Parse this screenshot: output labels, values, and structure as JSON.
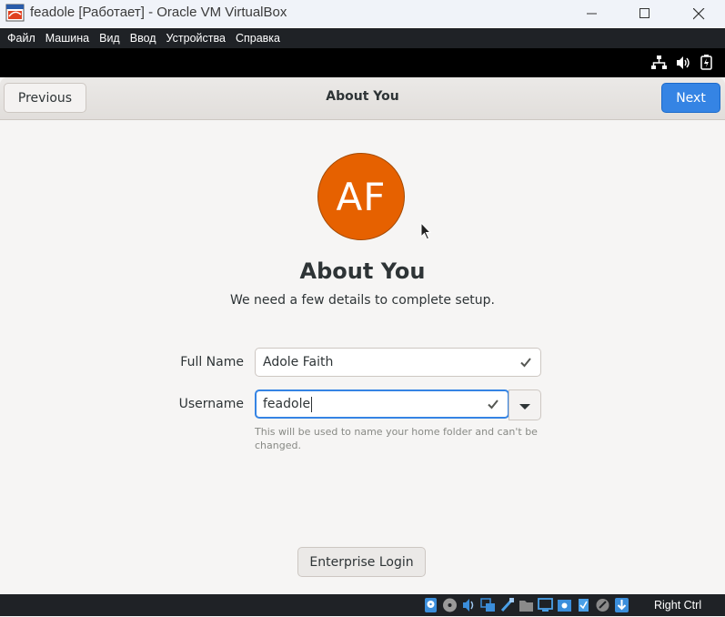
{
  "window": {
    "title": "feadole [Работает] - Oracle VM VirtualBox",
    "menu": [
      "Файл",
      "Машина",
      "Вид",
      "Ввод",
      "Устройства",
      "Справка"
    ],
    "host_key": "Right Ctrl"
  },
  "header": {
    "previous_label": "Previous",
    "title": "About You",
    "next_label": "Next"
  },
  "content": {
    "avatar_initials": "AF",
    "heading": "About You",
    "subtitle": "We need a few details to complete setup.",
    "full_name_label": "Full Name",
    "full_name_value": "Adole Faith",
    "username_label": "Username",
    "username_value": "feadole",
    "hint": "This will be used to name your home folder and can't be changed.",
    "enterprise_login_label": "Enterprise Login"
  },
  "icons": {
    "topbar": [
      "network-icon",
      "volume-icon",
      "battery-icon"
    ],
    "statusbar": [
      "hard-disk-icon",
      "optical-drive-icon",
      "audio-icon",
      "network-icon",
      "usb-icon",
      "shared-folders-icon",
      "display-icon",
      "recording-icon",
      "cpu-icon",
      "mouse-integration-icon",
      "keyboard-capture-icon"
    ]
  },
  "colors": {
    "accent": "#3584e4",
    "avatar": "#e66100"
  }
}
